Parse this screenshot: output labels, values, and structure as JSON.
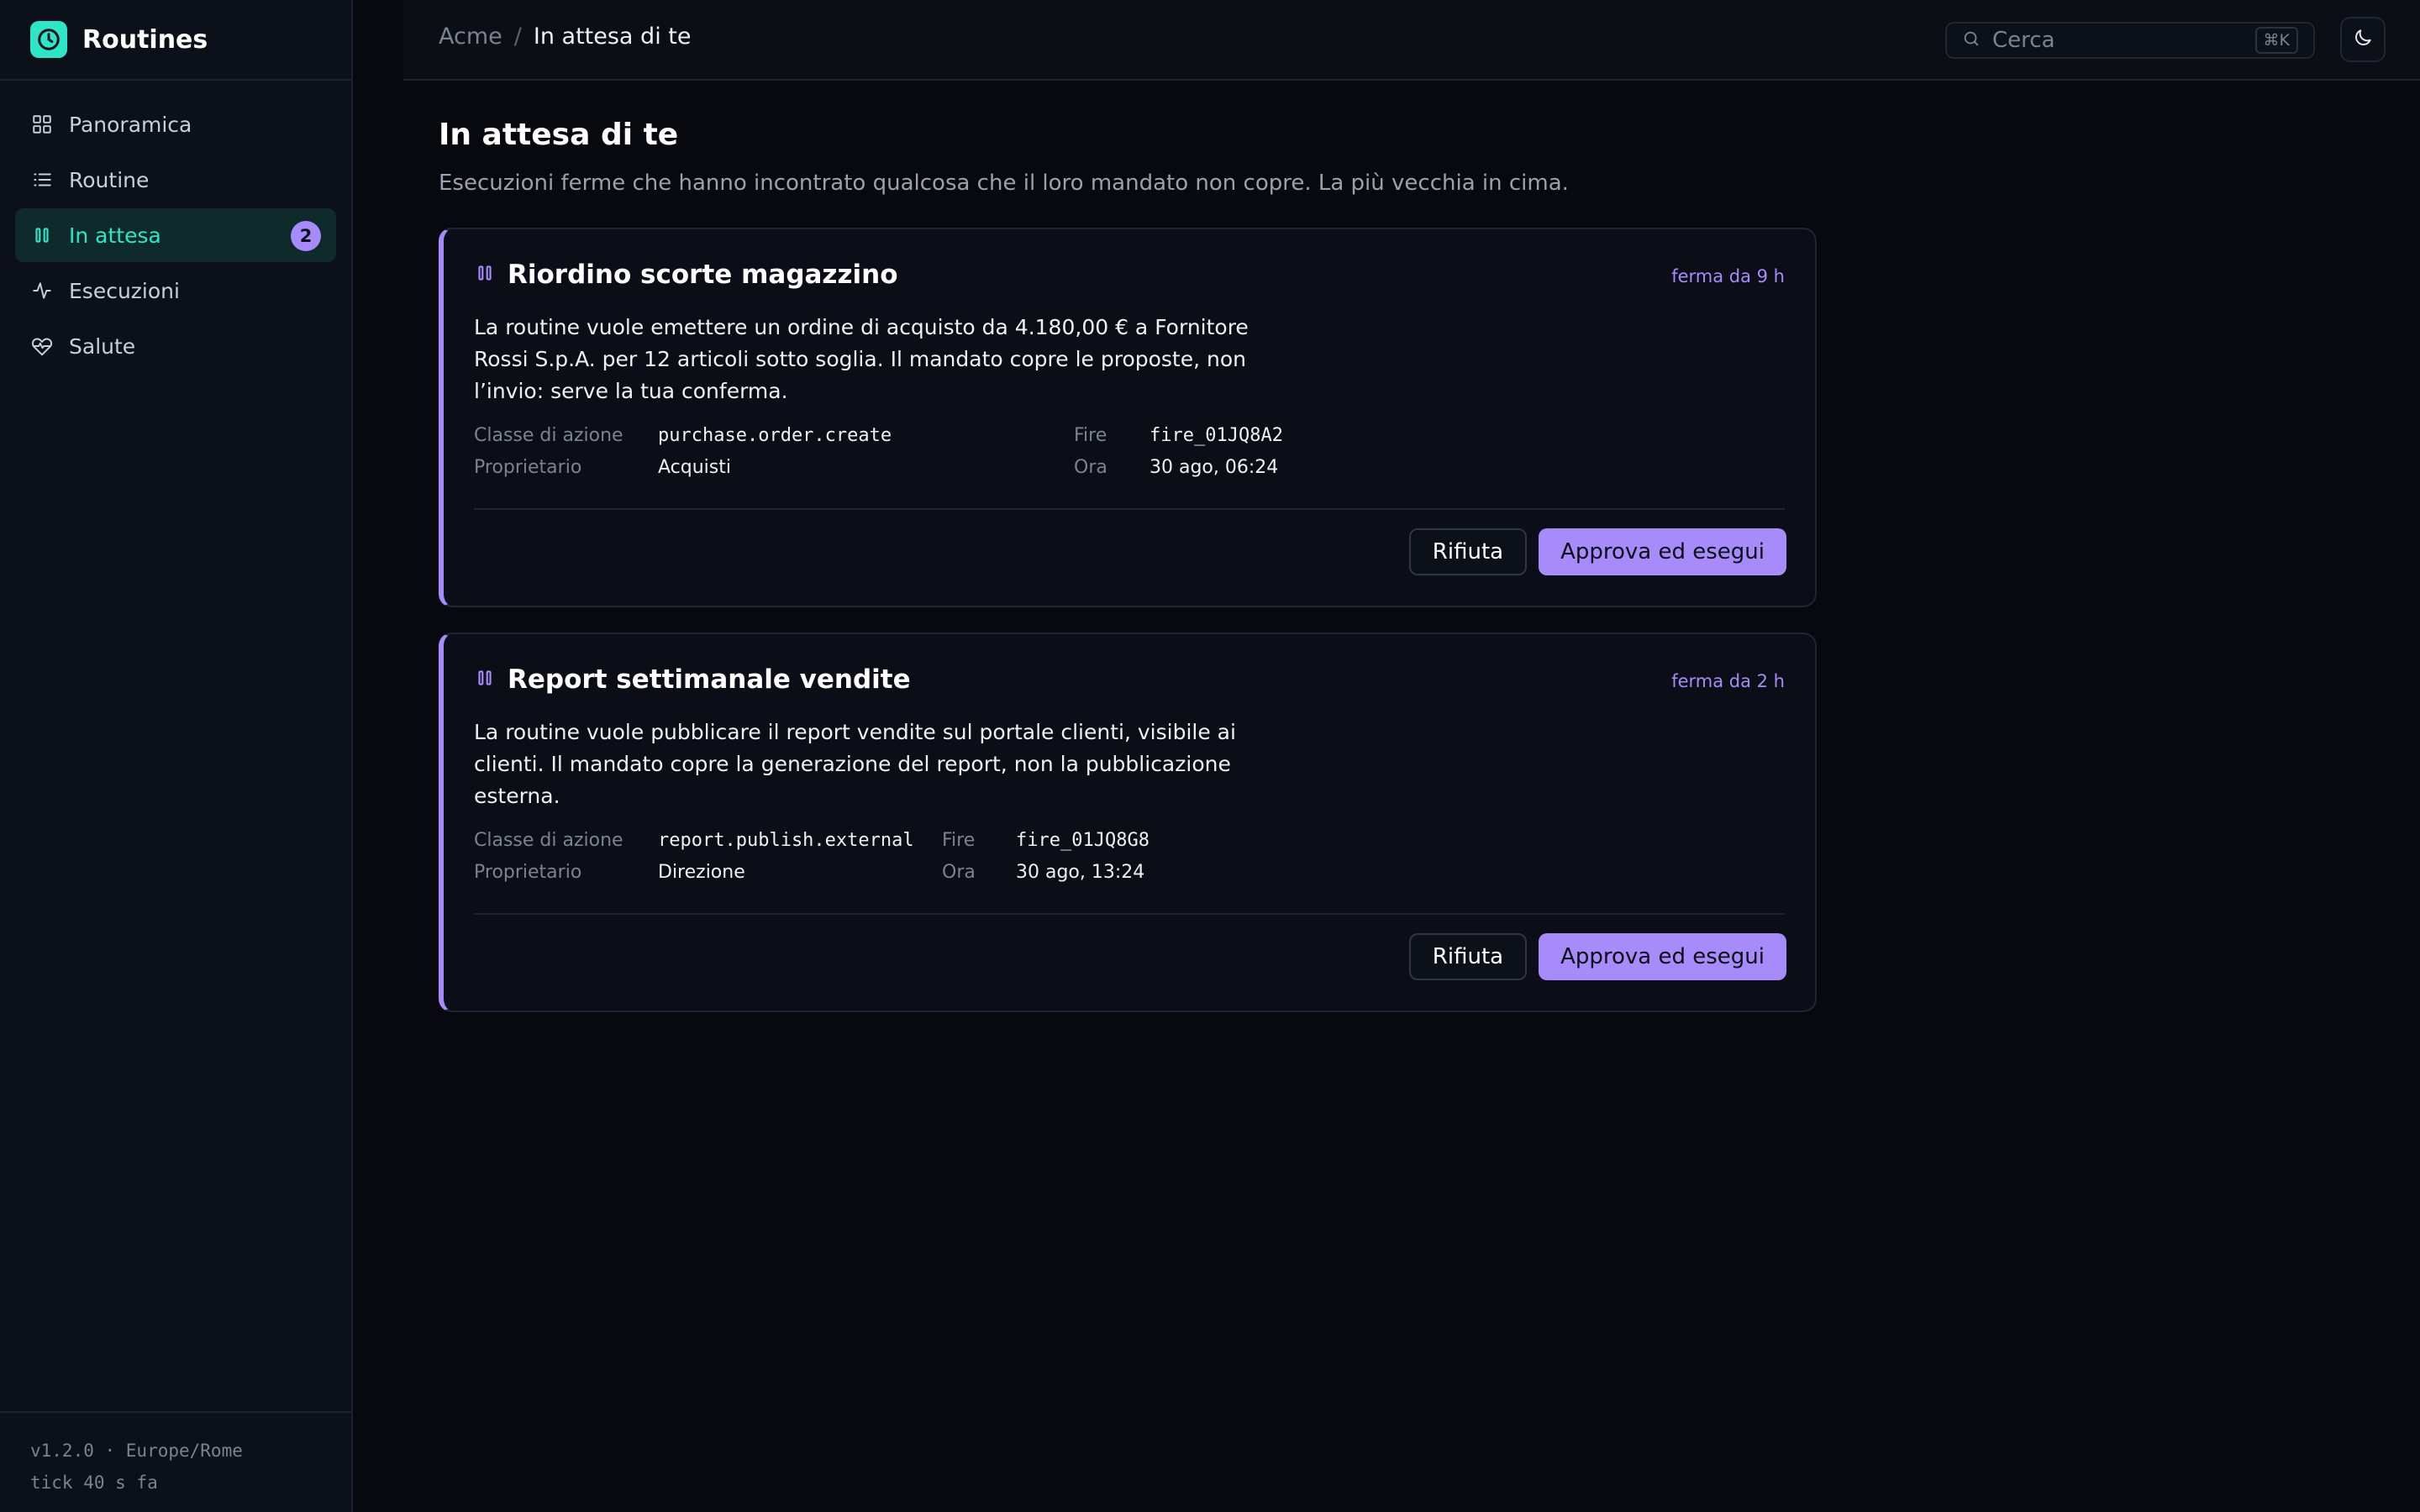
{
  "app": {
    "name": "Routines"
  },
  "sidebar": {
    "items": [
      {
        "label": "Panoramica",
        "icon": "grid-icon"
      },
      {
        "label": "Routine",
        "icon": "list-icon"
      },
      {
        "label": "In attesa",
        "icon": "pause-icon",
        "badge": "2",
        "active": true
      },
      {
        "label": "Esecuzioni",
        "icon": "activity-icon"
      },
      {
        "label": "Salute",
        "icon": "heart-pulse-icon"
      }
    ],
    "footer_line1": "v1.2.0 · Europe/Rome",
    "footer_line2": "tick 40 s fa"
  },
  "topbar": {
    "breadcrumb_root": "Acme",
    "breadcrumb_sep": "/",
    "breadcrumb_current": "In attesa di te",
    "search_placeholder": "Cerca",
    "search_shortcut": "⌘K"
  },
  "page": {
    "title": "In attesa di te",
    "subtitle": "Esecuzioni ferme che hanno incontrato qualcosa che il loro mandato non copre. La più vecchia in cima."
  },
  "labels": {
    "action_class": "Classe di azione",
    "owner": "Proprietario",
    "fire": "Fire",
    "time": "Ora",
    "reject": "Rifiuta",
    "approve": "Approva ed esegui"
  },
  "cards": [
    {
      "title": "Riordino scorte magazzino",
      "age": "ferma da 9 h",
      "description": "La routine vuole emettere un ordine di acquisto da 4.180,00 € a Fornitore Rossi S.p.A. per 12 articoli sotto soglia. Il mandato copre le proposte, non l’invio: serve la tua conferma.",
      "action_class": "purchase.order.create",
      "owner": "Acquisti",
      "fire": "fire_01JQ8A2",
      "time": "30 ago, 06:24"
    },
    {
      "title": "Report settimanale vendite",
      "age": "ferma da 2 h",
      "description": "La routine vuole pubblicare il report vendite sul portale clienti, visibile ai clienti. Il mandato copre la generazione del report, non la pubblicazione esterna.",
      "action_class": "report.publish.external",
      "owner": "Direzione",
      "fire": "fire_01JQ8G8",
      "time": "30 ago, 13:24"
    }
  ],
  "colors": {
    "accent": "#2ee6c7",
    "pending": "#a78bfa",
    "background": "#07090e"
  }
}
